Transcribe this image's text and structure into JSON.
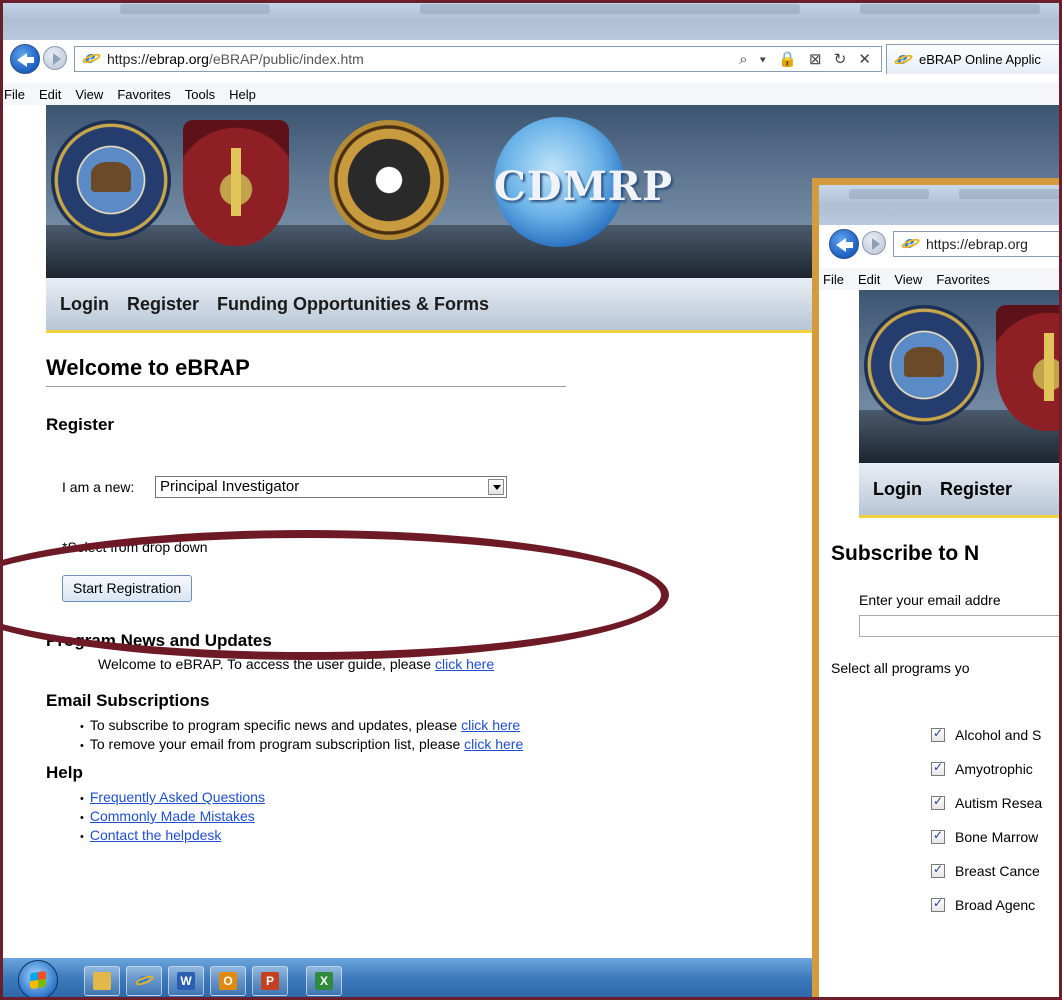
{
  "browser": {
    "back_icon": "back-arrow-icon",
    "forward_icon": "forward-arrow-icon",
    "url_scheme": "https://",
    "url_host": "ebrap.org",
    "url_path": "/eBRAP/public/index.htm",
    "address_tools": "⌕ ▾ 🔒 ⊠ ↻ ✕",
    "tab_title": "eBRAP Online Applic",
    "menu": [
      "File",
      "Edit",
      "View",
      "Favorites",
      "Tools",
      "Help"
    ]
  },
  "nav": {
    "login": "Login",
    "register": "Register",
    "funding": "Funding Opportunities & Forms"
  },
  "banner": {
    "cdmrp_text": "CDMRP"
  },
  "main": {
    "title": "Welcome to eBRAP",
    "register_heading": "Register",
    "iam_label": "I am a new:",
    "role_selected": "Principal Investigator",
    "select_hint": "*Select from drop down",
    "start_button": "Start Registration",
    "news_heading": "Program News and Updates",
    "news_text": "Welcome to eBRAP. To access the user guide, please ",
    "news_link": "click here",
    "email_heading": "Email Subscriptions",
    "email_items": [
      {
        "text": "To subscribe to program specific news and updates, please ",
        "link": "click here"
      },
      {
        "text": "To remove your email from program subscription list, please ",
        "link": "click here"
      }
    ],
    "help_heading": "Help",
    "help_links": [
      "Frequently Asked Questions",
      "Commonly Made Mistakes",
      "Contact the helpdesk"
    ]
  },
  "taskbar": {
    "apps": [
      "explorer",
      "internet-explorer",
      "W",
      "O",
      "P",
      "X"
    ]
  },
  "popup": {
    "url": "https://ebrap.org",
    "menu": [
      "File",
      "Edit",
      "View",
      "Favorites"
    ],
    "nav_login": "Login",
    "nav_register": "Register",
    "title": "Subscribe to N",
    "email_label": "Enter your email addre",
    "select_label": "Select all programs yo",
    "programs": [
      "Alcohol and S",
      "Amyotrophic",
      "Autism Resea",
      "Bone Marrow",
      "Breast Cance",
      "Broad Agenc"
    ]
  },
  "colors": {
    "frame": "#6b1f2a",
    "popup_border": "#d49a3e",
    "ellipse": "#6d1a26",
    "nav_underline": "#f1d23c",
    "link": "#1f4fd1"
  }
}
